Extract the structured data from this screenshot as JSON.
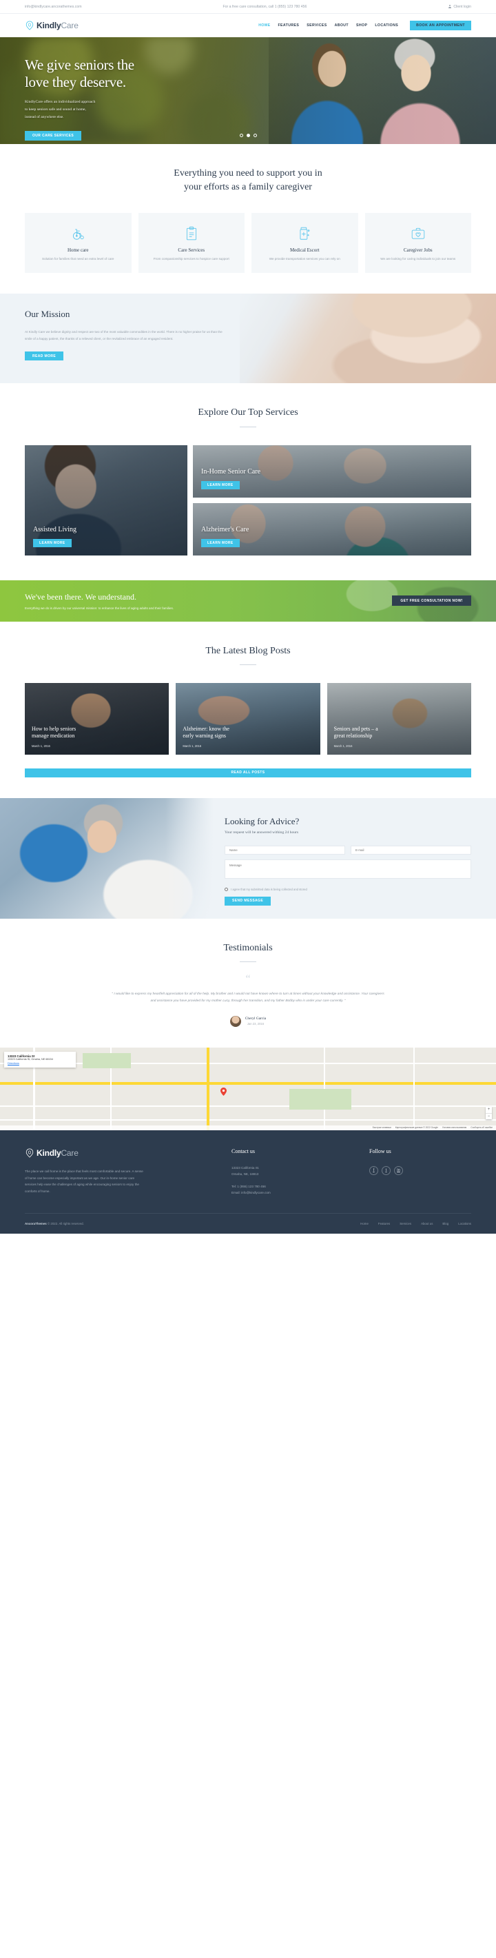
{
  "topbar": {
    "email": "info@kindlycare.ancorathemes.com",
    "consultation": "For a free care consultation, call  1 (855) 123 780 456",
    "client_login": "Client login"
  },
  "brand": {
    "name_bold": "Kindly",
    "name_light": "Care"
  },
  "nav": {
    "items": [
      {
        "label": "HOME",
        "active": true
      },
      {
        "label": "FEATURES",
        "active": false
      },
      {
        "label": "SERVICES",
        "active": false
      },
      {
        "label": "ABOUT",
        "active": false
      },
      {
        "label": "SHOP",
        "active": false
      },
      {
        "label": "LOCATIONS",
        "active": false
      }
    ],
    "cta": "BOOK AN APPOINTMENT"
  },
  "hero": {
    "title_line1": "We give seniors the",
    "title_line2": "love they deserve.",
    "text_line1": "KindlyCare offers an individualized approach",
    "text_line2": "to keep seniors safe and sound at home,",
    "text_line3": "instead of anywhere else.",
    "button": "OUR CARE SERVICES",
    "slide_current": 2,
    "slide_total": 3
  },
  "features": {
    "title_line1": "Everything you need to support you in",
    "title_line2": "your efforts as a family caregiver",
    "cards": [
      {
        "icon": "wheelchair-icon",
        "title": "Home care",
        "text": "Solution for families that need an extra level of care"
      },
      {
        "icon": "clipboard-icon",
        "title": "Care Services",
        "text": "From companionship services to hospice care support"
      },
      {
        "icon": "medicine-bottle-icon",
        "title": "Medical Escort",
        "text": "We provide transportation services you can rely on"
      },
      {
        "icon": "first-aid-kit-icon",
        "title": "Caregiver Jobs",
        "text": "We are looking for caring individuals to join our teams"
      }
    ]
  },
  "mission": {
    "title": "Our Mission",
    "text": "At Kindly Care we believe dignity and respect are two of the most valuable commodities in the world. There is no higher praise for us than the smile of a happy patient, the thanks of a relieved client, or the revitalized embrace of an engaged resident.",
    "button": "READ MORE"
  },
  "top_services": {
    "title": "Explore Our Top Services",
    "tiles": [
      {
        "title": "Assisted Living",
        "button": "LEARN MORE"
      },
      {
        "title": "In-Home Senior Care",
        "button": "LEARN MORE"
      },
      {
        "title": "Alzheimer's Care",
        "button": "LEARN MORE"
      }
    ]
  },
  "cta": {
    "title": "We've been there. We understand.",
    "subtitle": "Everything we do is driven by our universal mission: to enhance the lives of aging adults and their families.",
    "button": "Get FREE consultation now!"
  },
  "blog": {
    "title": "The Latest Blog Posts",
    "posts": [
      {
        "title_line1": "How to help seniors",
        "title_line2": "manage medication",
        "date": "March 1, 2016"
      },
      {
        "title_line1": "Alzheimer: know the",
        "title_line2": "early warning signs",
        "date": "March 1, 2016"
      },
      {
        "title_line1": "Seniors and pets – a",
        "title_line2": "great relationship",
        "date": "March 1, 2016"
      }
    ],
    "button": "READ ALL POSTS"
  },
  "advice": {
    "title": "Looking for Advice?",
    "subtitle": "Your request will be answered withing 24 hours",
    "name_placeholder": "Name",
    "email_placeholder": "E-mail",
    "message_placeholder": "Message",
    "consent": "I agree that my submitted data is being collected and stored",
    "button": "SEND MESSAGE"
  },
  "testimonials": {
    "title": "Testimonials",
    "quote": "\" I would like to express my heartfelt appreciation for all of the help. My brother and I would not have known where to turn at times without your knowledge and assistance. Your caregivers and assistance you have provided for my mother Lucy, through her transition, and my father Bobby who is under your care currently. \"",
    "author": "Cheryl Garcia",
    "date": "Jan 23, 2016"
  },
  "map": {
    "card_title": "13323 California St",
    "card_line": "13323 California St, Omaha, NE 68154",
    "directions": "Directions",
    "pin_label": "13323 California St Omaha, NE 68154",
    "attribution": "Картографические данные © 2022 Google",
    "terms": "Условия использования",
    "report": "Сообщить об ошибке",
    "shortcuts": "Быстрые клавиши",
    "zoom_in": "+",
    "zoom_out": "−"
  },
  "footer": {
    "about": "The place we call home is the place that feels most comfortable and secure. A sense of home can become especially important as we age. Our in-home senior care services help ease the challenges of aging while encouraging seniors to enjoy the comforts of home.",
    "contact_heading": "Contact us",
    "address_line1": "13323 California St.",
    "address_line2": "Omaha, NE, 18813",
    "tel": "Tel: 1 (855) 123 780 456",
    "email": "Email: info@kindlycare.com",
    "follow_heading": "Follow us",
    "socials": [
      {
        "icon": "facebook-icon",
        "glyph": "f"
      },
      {
        "icon": "twitter-icon",
        "glyph": "t"
      },
      {
        "icon": "linkedin-icon",
        "glyph": "in"
      }
    ],
    "copyright_brand": "AncoraThemes",
    "copyright_rest": " © 2022. All rights reserved.",
    "links": [
      "Home",
      "Features",
      "Services",
      "About us",
      "Blog",
      "Locations"
    ]
  },
  "colors": {
    "accent": "#3fc3e8",
    "dark": "#2d3c4e",
    "green": "#8ec63f"
  }
}
